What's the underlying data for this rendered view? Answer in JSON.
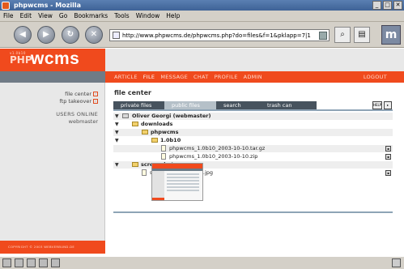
{
  "window": {
    "title": "phpwcms - Mozilla",
    "controls": [
      "_",
      "□",
      "✕"
    ]
  },
  "menu": [
    "File",
    "Edit",
    "View",
    "Go",
    "Bookmarks",
    "Tools",
    "Window",
    "Help"
  ],
  "toolbar": {
    "back": "◀",
    "forward": "▶",
    "reload": "↻",
    "stop": "✕",
    "url": "http://www.phpwcms.de/phpwcms.php?do=files&f=1&pklapp=7|1",
    "throbber": "m"
  },
  "logo": {
    "small": "v1.0b10",
    "php": "PHP",
    "wcms": "wcms"
  },
  "nav": {
    "items": [
      "ARTICLE",
      "FILE",
      "MESSAGE",
      "CHAT",
      "PROFILE",
      "ADMIN"
    ],
    "active": "FILE",
    "logout": "LOGOUT"
  },
  "sidebar": {
    "links": [
      "file center",
      "ftp takeover"
    ],
    "users_online_label": "USERS ONLINE",
    "user": "webmaster"
  },
  "footer": {
    "copyright": "COPYRIGHT © 2003 WEBVERBUND.DE"
  },
  "filecenter": {
    "title": "file center",
    "tabs": [
      "private files",
      "public files",
      "search",
      "trash can"
    ],
    "help": "HELP",
    "rows": [
      {
        "label": "Oliver Georgi (webmaster)",
        "kind": "user",
        "indent": 0,
        "bold": true
      },
      {
        "label": "downloads",
        "kind": "folder",
        "indent": 1,
        "bold": true
      },
      {
        "label": "phpwcms",
        "kind": "folder",
        "indent": 2,
        "bold": true
      },
      {
        "label": "1.0b10",
        "kind": "folder",
        "indent": 3,
        "bold": true
      },
      {
        "label": "phpwcms_1.0b10_2003-10-10.tar.gz",
        "kind": "file",
        "indent": 4,
        "bold": false
      },
      {
        "label": "phpwcms_1.0b10_2003-10-10.zip",
        "kind": "file",
        "indent": 4,
        "bold": false
      },
      {
        "label": "screenshots",
        "kind": "folder",
        "indent": 1,
        "bold": true
      },
      {
        "label": "structure_article_list.jpg",
        "kind": "file",
        "indent": 2,
        "bold": false
      }
    ]
  }
}
